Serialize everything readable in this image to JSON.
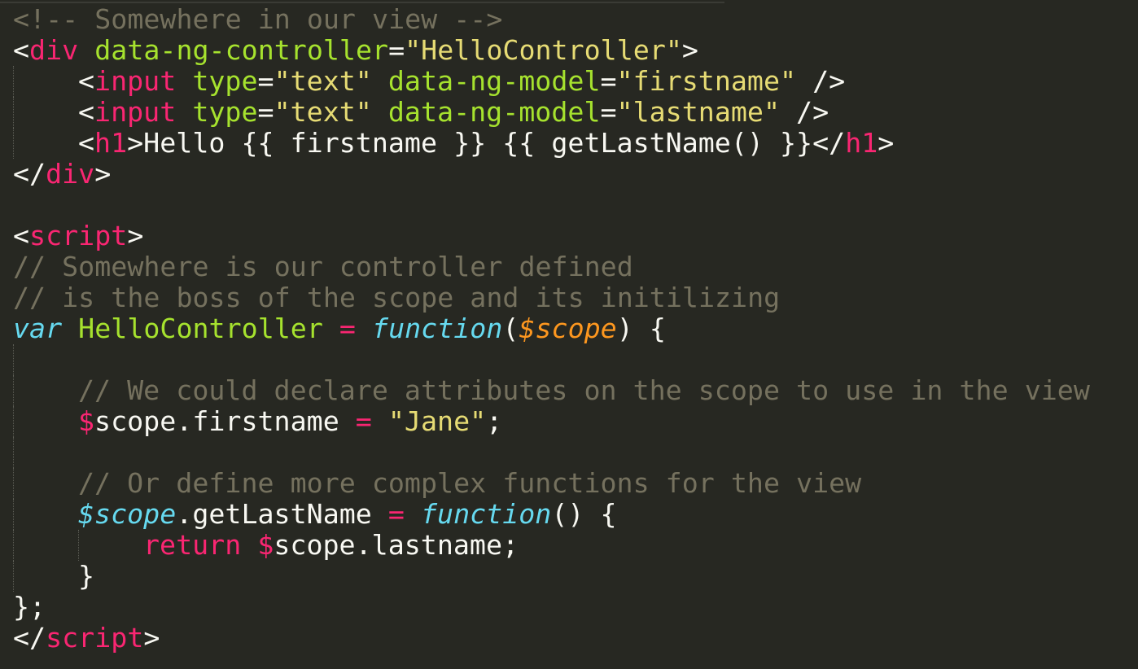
{
  "colors": {
    "background": "#272822",
    "comment": "#75715e",
    "tag": "#f92672",
    "attribute": "#a6e22e",
    "string": "#e6db74",
    "text": "#f8f8f2",
    "storage": "#66d9ef",
    "parameter": "#fd971f"
  },
  "lines": [
    {
      "t1": "<!-- Somewhere in our view -->"
    },
    {
      "t1": "<",
      "t2": "div",
      "t3": " data-ng-controller",
      "t4": "=",
      "t5": "\"HelloController\"",
      "t6": ">"
    },
    {
      "t1": "<",
      "t2": "input",
      "t3": " type",
      "t4": "=",
      "t5": "\"text\"",
      "t6": " data-ng-model",
      "t7": "=",
      "t8": "\"firstname\"",
      "t9": " />"
    },
    {
      "t1": "<",
      "t2": "input",
      "t3": " type",
      "t4": "=",
      "t5": "\"text\"",
      "t6": " data-ng-model",
      "t7": "=",
      "t8": "\"lastname\"",
      "t9": " />"
    },
    {
      "t1": "<",
      "t2": "h1",
      "t3": ">Hello {{ firstname }} {{ getLastName() }}</",
      "t4": "h1",
      "t5": ">"
    },
    {
      "t1": "</",
      "t2": "div",
      "t3": ">"
    },
    {},
    {
      "t1": "<",
      "t2": "script",
      "t3": ">"
    },
    {
      "t1": "// Somewhere is our controller defined"
    },
    {
      "t1": "// is the boss of the scope and its initilizing"
    },
    {
      "t1": "var",
      "t2": " HelloController",
      "t3": " = ",
      "t4": "function",
      "t5": "(",
      "t6": "$scope",
      "t7": ") {"
    },
    {},
    {
      "t1": "// We could declare attributes on the scope to use in the view"
    },
    {
      "t1": "$",
      "t2": "scope.firstname ",
      "t3": "=",
      "t4": " ",
      "t5": "\"Jane\"",
      "t6": ";"
    },
    {},
    {
      "t1": "// Or define more complex functions for the view"
    },
    {
      "t1": "$scope",
      "t2": ".getLastName ",
      "t3": "=",
      "t4": " ",
      "t5": "function",
      "t6": "() {"
    },
    {
      "t1": "return",
      "t2": " ",
      "t3": "$",
      "t4": "scope.lastname;"
    },
    {
      "t1": "}"
    },
    {
      "t1": "};"
    },
    {
      "t1": "</",
      "t2": "script",
      "t3": ">"
    }
  ]
}
